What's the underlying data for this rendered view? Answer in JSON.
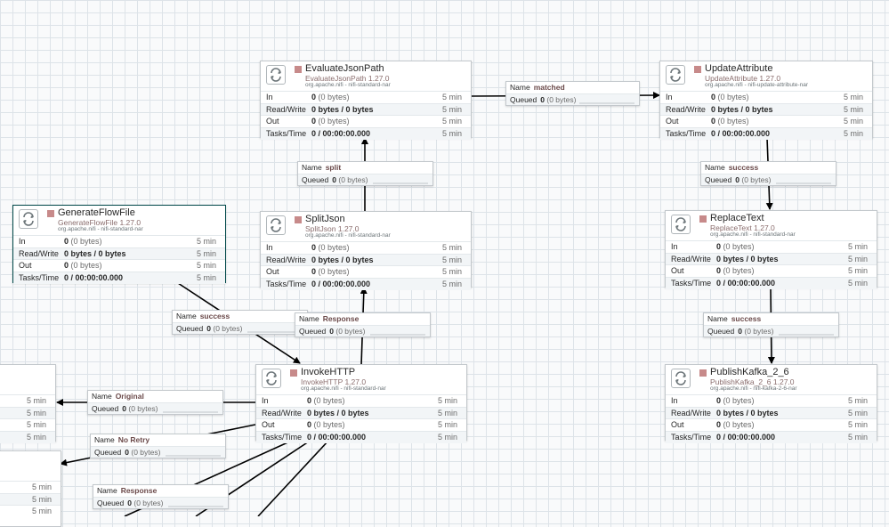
{
  "canvas": {
    "row_labels": {
      "in": "In",
      "rw": "Read/Write",
      "out": "Out",
      "tasks": "Tasks/Time"
    },
    "time_label": "5 min",
    "conn_labels": {
      "name": "Name",
      "queued": "Queued"
    }
  },
  "processors": {
    "evaluate": {
      "name": "EvaluateJsonPath",
      "type": "EvaluateJsonPath 1.27.0",
      "bundle": "org.apache.nifi - nifi-standard-nar",
      "in_count": "0",
      "in_bytes": "(0 bytes)",
      "rw": "0 bytes / 0 bytes",
      "out_count": "0",
      "out_bytes": "(0 bytes)",
      "tasks": "0 / 00:00:00.000"
    },
    "update": {
      "name": "UpdateAttribute",
      "type": "UpdateAttribute 1.27.0",
      "bundle": "org.apache.nifi - nifi-update-attribute-nar",
      "in_count": "0",
      "in_bytes": "(0 bytes)",
      "rw": "0 bytes / 0 bytes",
      "out_count": "0",
      "out_bytes": "(0 bytes)",
      "tasks": "0 / 00:00:00.000"
    },
    "generate": {
      "name": "GenerateFlowFile",
      "type": "GenerateFlowFile 1.27.0",
      "bundle": "org.apache.nifi - nifi-standard-nar",
      "in_count": "0",
      "in_bytes": "(0 bytes)",
      "rw": "0 bytes / 0 bytes",
      "out_count": "0",
      "out_bytes": "(0 bytes)",
      "tasks": "0 / 00:00:00.000"
    },
    "split": {
      "name": "SplitJson",
      "type": "SplitJson 1.27.0",
      "bundle": "org.apache.nifi - nifi-standard-nar",
      "in_count": "0",
      "in_bytes": "(0 bytes)",
      "rw": "0 bytes / 0 bytes",
      "out_count": "0",
      "out_bytes": "(0 bytes)",
      "tasks": "0 / 00:00:00.000"
    },
    "replace": {
      "name": "ReplaceText",
      "type": "ReplaceText 1.27.0",
      "bundle": "org.apache.nifi - nifi-standard-nar",
      "in_count": "0",
      "in_bytes": "(0 bytes)",
      "rw": "0 bytes / 0 bytes",
      "out_count": "0",
      "out_bytes": "(0 bytes)",
      "tasks": "0 / 00:00:00.000"
    },
    "invoke": {
      "name": "InvokeHTTP",
      "type": "InvokeHTTP 1.27.0",
      "bundle": "org.apache.nifi - nifi-standard-nar",
      "in_count": "0",
      "in_bytes": "(0 bytes)",
      "rw": "0 bytes / 0 bytes",
      "out_count": "0",
      "out_bytes": "(0 bytes)",
      "tasks": "0 / 00:00:00.000"
    },
    "publish": {
      "name": "PublishKafka_2_6",
      "type": "PublishKafka_2_6 1.27.0",
      "bundle": "org.apache.nifi - nifi-kafka-2-6-nar",
      "in_count": "0",
      "in_bytes": "(0 bytes)",
      "rw": "0 bytes / 0 bytes",
      "out_count": "0",
      "out_bytes": "(0 bytes)",
      "tasks": "0 / 00:00:00.000"
    }
  },
  "connections": {
    "matched": {
      "name": "matched",
      "queued_count": "0",
      "queued_bytes": "(0 bytes)"
    },
    "split": {
      "name": "split",
      "queued_count": "0",
      "queued_bytes": "(0 bytes)"
    },
    "success_update": {
      "name": "success",
      "queued_count": "0",
      "queued_bytes": "(0 bytes)"
    },
    "success_generate": {
      "name": "success",
      "queued_count": "0",
      "queued_bytes": "(0 bytes)"
    },
    "response_invoke": {
      "name": "Response",
      "queued_count": "0",
      "queued_bytes": "(0 bytes)"
    },
    "success_replace": {
      "name": "success",
      "queued_count": "0",
      "queued_bytes": "(0 bytes)"
    },
    "original": {
      "name": "Original",
      "queued_count": "0",
      "queued_bytes": "(0 bytes)"
    },
    "noretry": {
      "name": "No Retry",
      "queued_count": "0",
      "queued_bytes": "(0 bytes)"
    },
    "response_left": {
      "name": "Response",
      "queued_count": "0",
      "queued_bytes": "(0 bytes)"
    }
  }
}
